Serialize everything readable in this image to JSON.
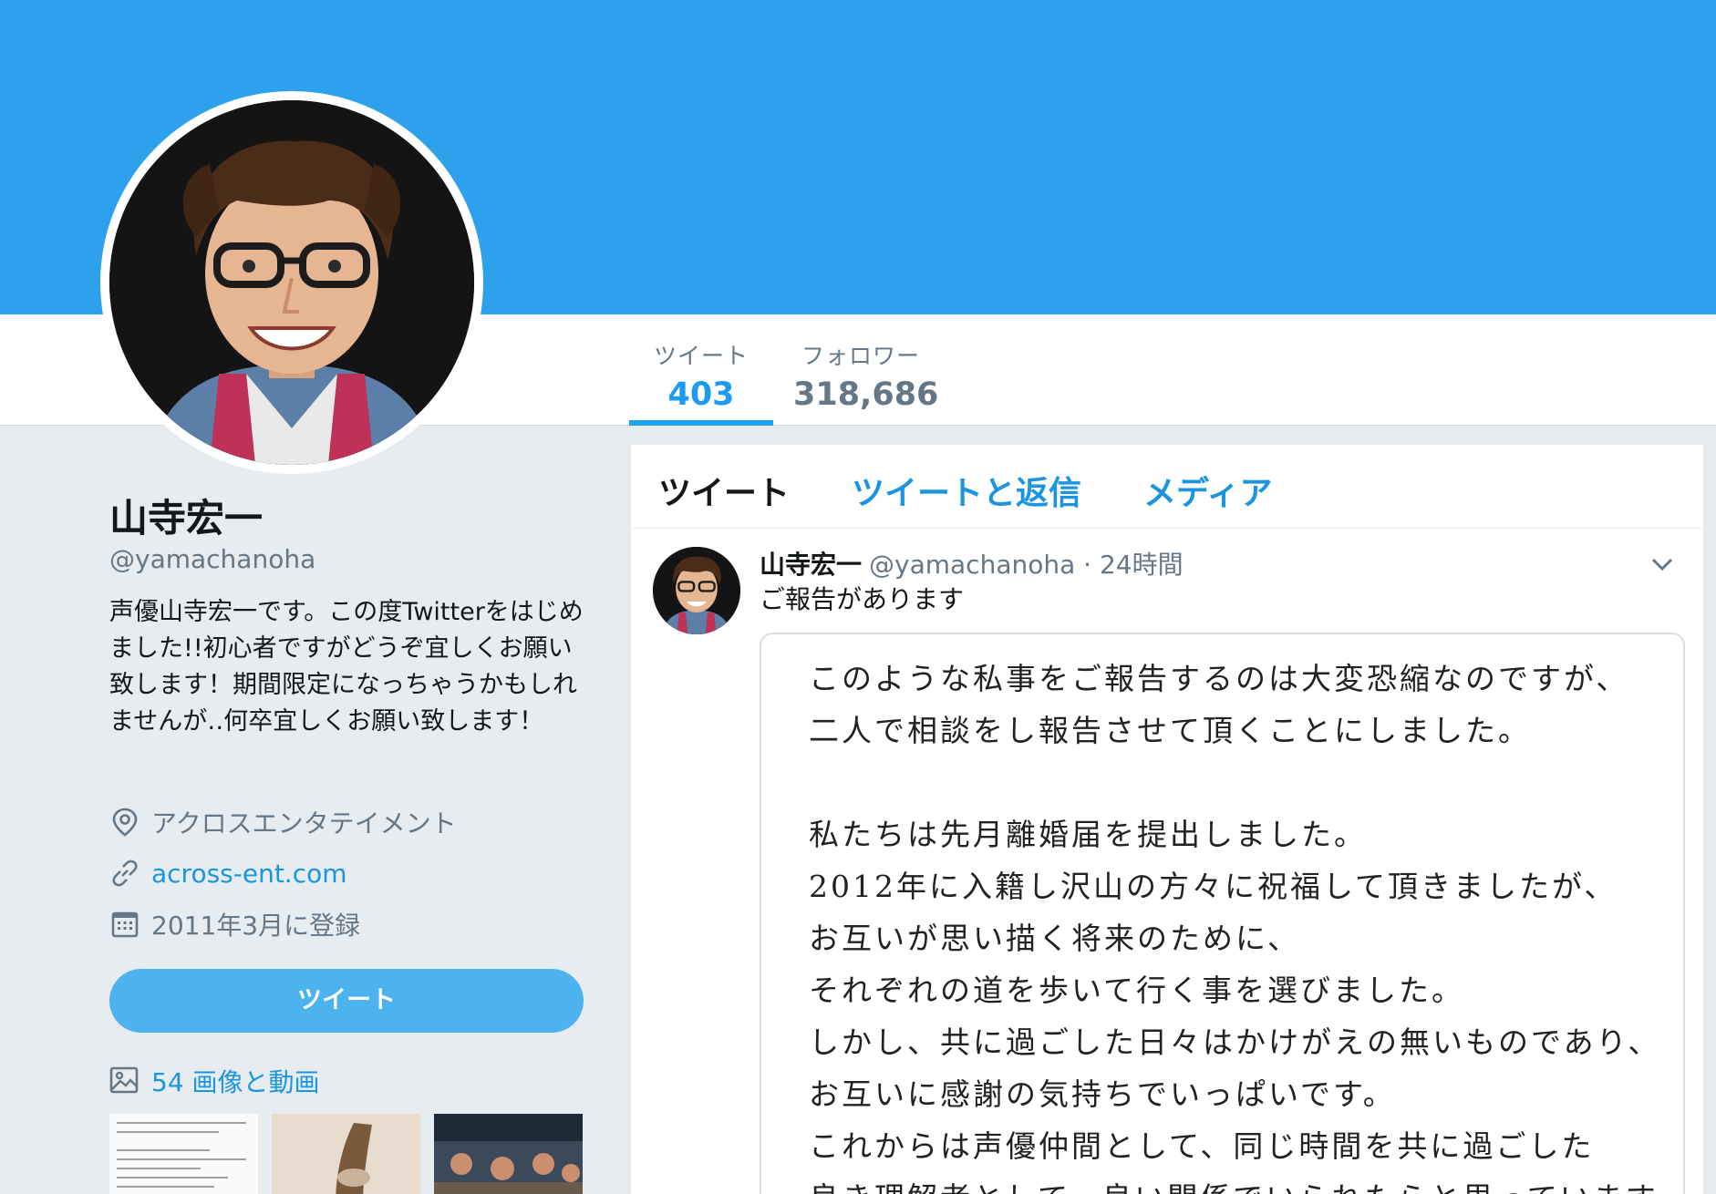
{
  "profile": {
    "name": "山寺宏一",
    "handle": "@yamachanoha",
    "bio": "声優山寺宏一です。この度Twitterをはじめました!!初心者ですがどうぞ宜しくお願い致します！期間限定になっちゃうかもしれませんが‥何卒宜しくお願い致します！",
    "location": "アクロスエンタテイメント",
    "website": "across-ent.com",
    "joined": "2011年3月に登録",
    "tweet_button": "ツイート",
    "media_link": "54 画像と動画"
  },
  "stats": [
    {
      "label": "ツイート",
      "value": "403"
    },
    {
      "label": "フォロワー",
      "value": "318,686"
    }
  ],
  "timeline": {
    "tabs": [
      "ツイート",
      "ツイートと返信",
      "メディア"
    ],
    "tweet": {
      "author": "山寺宏一",
      "handle": "@yamachanoha",
      "time": "· 24時間",
      "text": "ご報告があります",
      "card_lines": [
        "このような私事をご報告するのは大変恐縮なのですが、",
        "二人で相談をし報告させて頂くことにしました。",
        "",
        "私たちは先月離婚届を提出しました。",
        "2012年に入籍し沢山の方々に祝福して頂きましたが、",
        "お互いが思い描く将来のために、",
        "それぞれの道を歩いて行く事を選びました。",
        "しかし、共に過ごした日々はかけがえの無いものであり、",
        "お互いに感謝の気持ちでいっぱいです。",
        "これからは声優仲間として、同じ時間を共に過ごした",
        "良き理解者として、良い関係でいられたらと思っています。"
      ]
    }
  },
  "icons": [
    "location-pin-icon",
    "link-icon",
    "calendar-icon",
    "image-icon",
    "chevron-down-icon"
  ],
  "colors": {
    "banner": "#2da1ec",
    "accent": "#1da1f2",
    "link": "#1b95e0",
    "button": "#4db3ef",
    "muted": "#657786"
  }
}
